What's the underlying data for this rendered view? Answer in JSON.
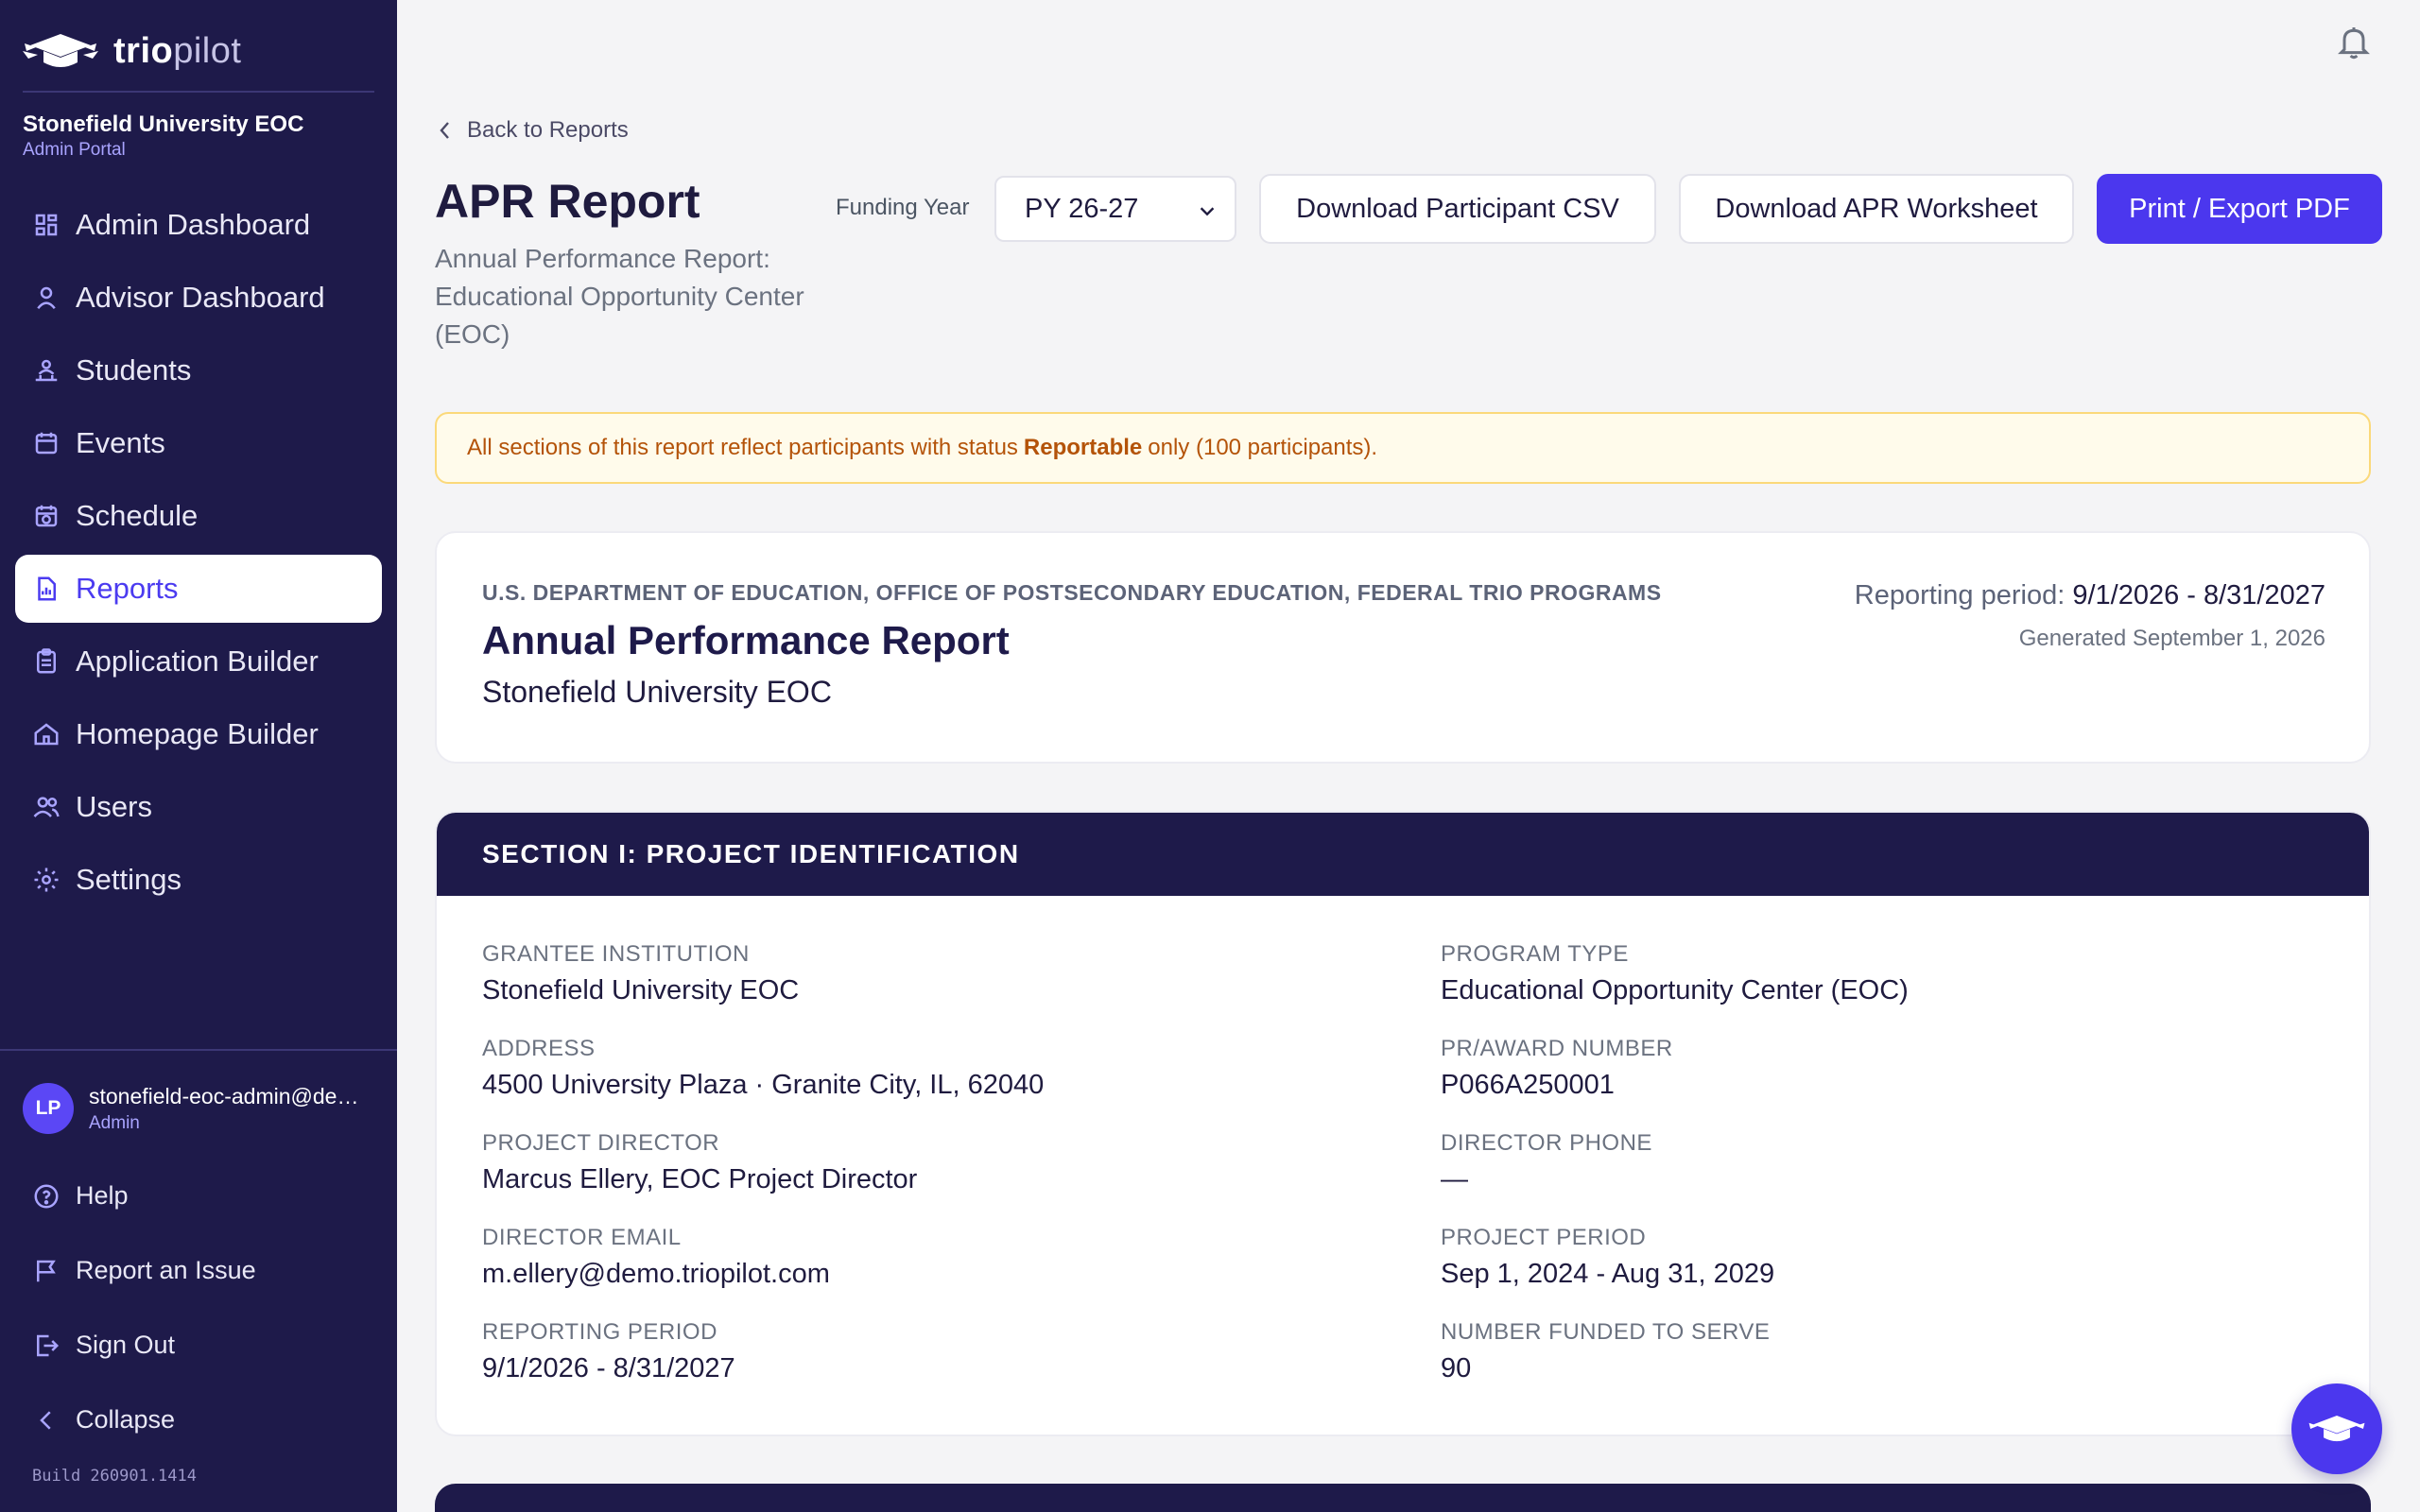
{
  "brand": {
    "name_bold": "trio",
    "name_light": "pilot"
  },
  "org": {
    "name": "Stonefield University EOC",
    "portal": "Admin Portal"
  },
  "nav": [
    {
      "label": "Admin Dashboard",
      "icon": "dashboard-icon"
    },
    {
      "label": "Advisor Dashboard",
      "icon": "user-icon"
    },
    {
      "label": "Students",
      "icon": "students-icon"
    },
    {
      "label": "Events",
      "icon": "calendar-icon"
    },
    {
      "label": "Schedule",
      "icon": "schedule-icon"
    },
    {
      "label": "Reports",
      "icon": "report-icon",
      "active": true
    },
    {
      "label": "Application Builder",
      "icon": "clipboard-icon"
    },
    {
      "label": "Homepage Builder",
      "icon": "home-icon"
    },
    {
      "label": "Users",
      "icon": "users-icon"
    },
    {
      "label": "Settings",
      "icon": "gear-icon"
    }
  ],
  "user": {
    "initials": "LP",
    "email": "stonefield-eoc-admin@demo.triopilot.com",
    "role": "Admin"
  },
  "footer": [
    {
      "label": "Help",
      "icon": "help-icon"
    },
    {
      "label": "Report an Issue",
      "icon": "flag-icon"
    },
    {
      "label": "Sign Out",
      "icon": "sign-out-icon"
    },
    {
      "label": "Collapse",
      "icon": "chevron-left-icon"
    }
  ],
  "build": "Build 260901.1414",
  "header": {
    "back": "Back to Reports",
    "title": "APR Report",
    "subtitle": "Annual Performance Report: Educational Opportunity Center (EOC)",
    "funding_label": "Funding Year",
    "funding_value": "PY 26-27",
    "btn_csv": "Download Participant CSV",
    "btn_worksheet": "Download APR Worksheet",
    "btn_pdf": "Print / Export PDF"
  },
  "notice": {
    "prefix": "All sections of this report reflect participants with status",
    "status": "Reportable",
    "suffix": "only (100 participants)."
  },
  "report": {
    "agency": "U.S. DEPARTMENT OF EDUCATION, OFFICE OF POSTSECONDARY EDUCATION, FEDERAL TRIO PROGRAMS",
    "title": "Annual Performance Report",
    "org": "Stonefield University EOC",
    "period_label": "Reporting period:",
    "period_value": "9/1/2026 - 8/31/2027",
    "generated": "Generated September 1, 2026"
  },
  "section1": {
    "title": "SECTION I: PROJECT IDENTIFICATION",
    "left": [
      {
        "label": "GRANTEE INSTITUTION",
        "value": "Stonefield University EOC"
      },
      {
        "label": "ADDRESS",
        "value": "4500 University Plaza · Granite City, IL, 62040"
      },
      {
        "label": "PROJECT DIRECTOR",
        "value": "Marcus Ellery, EOC Project Director"
      },
      {
        "label": "DIRECTOR EMAIL",
        "value": "m.ellery@demo.triopilot.com"
      },
      {
        "label": "REPORTING PERIOD",
        "value": "9/1/2026 - 8/31/2027"
      }
    ],
    "right": [
      {
        "label": "PROGRAM TYPE",
        "value": "Educational Opportunity Center (EOC)"
      },
      {
        "label": "PR/AWARD NUMBER",
        "value": "P066A250001"
      },
      {
        "label": "DIRECTOR PHONE",
        "value": "—"
      },
      {
        "label": "PROJECT PERIOD",
        "value": "Sep 1, 2024 - Aug 31, 2029"
      },
      {
        "label": "NUMBER FUNDED TO SERVE",
        "value": "90"
      }
    ]
  }
}
